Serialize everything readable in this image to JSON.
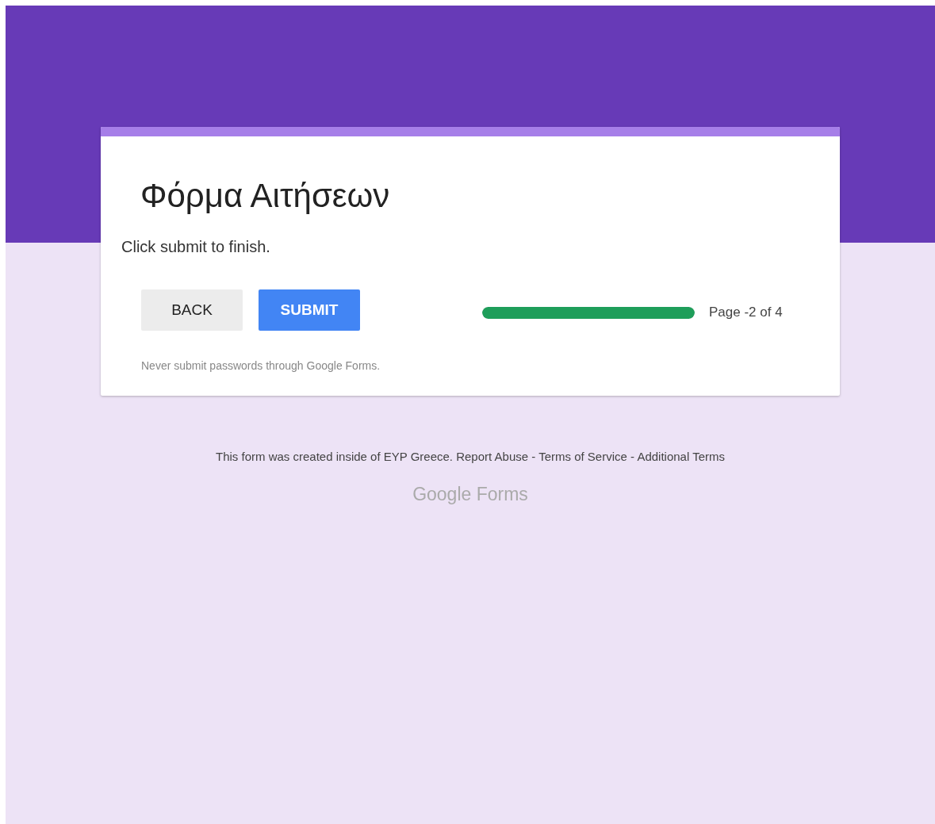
{
  "form": {
    "title": "Φόρμα Αιτήσεων",
    "description": "Click submit to finish."
  },
  "buttons": [
    {
      "label": "BACK",
      "kind": "secondary"
    },
    {
      "label": "SUBMIT",
      "kind": "primary"
    }
  ],
  "progress": {
    "level": 1,
    "label": "Page -2 of 4"
  },
  "warning": "Never submit passwords through Google Forms.",
  "footer": {
    "text": "This form was created inside of EYP Greece.",
    "separator": "-",
    "links": [
      "Report Abuse",
      "Terms of Service",
      "Additional Terms"
    ]
  },
  "brand": {
    "name": "Google",
    "product": "Forms"
  }
}
